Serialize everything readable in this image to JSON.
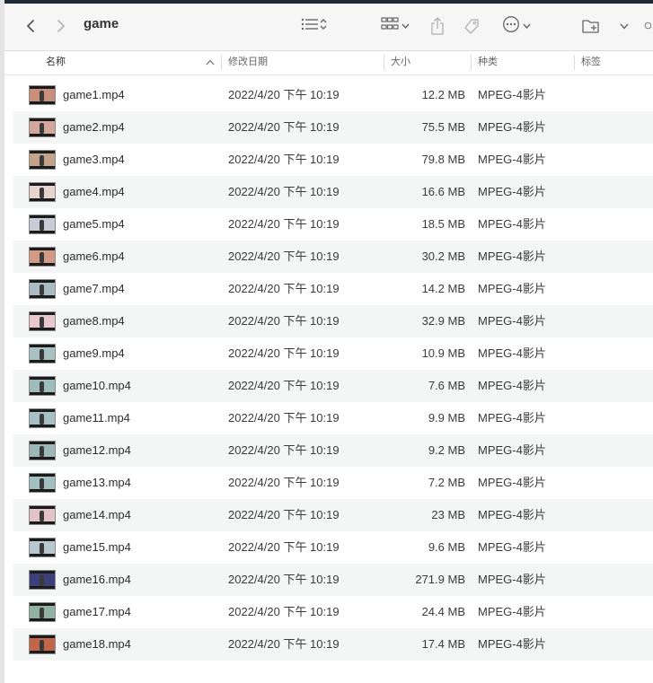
{
  "window": {
    "title": "game"
  },
  "toolbar": {
    "back_icon": "chevron-left-icon",
    "forward_icon": "chevron-right-icon",
    "list_view_icon": "list-icon",
    "grid_view_icon": "grid-icon",
    "share_icon": "share-icon",
    "tag_icon": "tag-icon",
    "more_icon": "ellipsis-circle-icon",
    "new_folder_icon": "folder-plus-icon"
  },
  "columns": {
    "name": "名称",
    "modified": "修改日期",
    "size": "大小",
    "kind": "种类",
    "tags": "标签"
  },
  "files": [
    {
      "name": "game1.mp4",
      "modified": "2022/4/20 下午 10:19",
      "size": "12.2 MB",
      "kind": "MPEG-4影片",
      "thumb": "#c98f7a"
    },
    {
      "name": "game2.mp4",
      "modified": "2022/4/20 下午 10:19",
      "size": "75.5 MB",
      "kind": "MPEG-4影片",
      "thumb": "#d4a79c"
    },
    {
      "name": "game3.mp4",
      "modified": "2022/4/20 下午 10:19",
      "size": "79.8 MB",
      "kind": "MPEG-4影片",
      "thumb": "#c4a28c"
    },
    {
      "name": "game4.mp4",
      "modified": "2022/4/20 下午 10:19",
      "size": "16.6 MB",
      "kind": "MPEG-4影片",
      "thumb": "#e6d5cf"
    },
    {
      "name": "game5.mp4",
      "modified": "2022/4/20 下午 10:19",
      "size": "18.5 MB",
      "kind": "MPEG-4影片",
      "thumb": "#c9ccd6"
    },
    {
      "name": "game6.mp4",
      "modified": "2022/4/20 下午 10:19",
      "size": "30.2 MB",
      "kind": "MPEG-4影片",
      "thumb": "#d39a86"
    },
    {
      "name": "game7.mp4",
      "modified": "2022/4/20 下午 10:19",
      "size": "14.2 MB",
      "kind": "MPEG-4影片",
      "thumb": "#a9bcc4"
    },
    {
      "name": "game8.mp4",
      "modified": "2022/4/20 下午 10:19",
      "size": "32.9 MB",
      "kind": "MPEG-4影片",
      "thumb": "#e8c8cc"
    },
    {
      "name": "game9.mp4",
      "modified": "2022/4/20 下午 10:19",
      "size": "10.9 MB",
      "kind": "MPEG-4影片",
      "thumb": "#a8c2c4"
    },
    {
      "name": "game10.mp4",
      "modified": "2022/4/20 下午 10:19",
      "size": "7.6 MB",
      "kind": "MPEG-4影片",
      "thumb": "#9fbcbc"
    },
    {
      "name": "game11.mp4",
      "modified": "2022/4/20 下午 10:19",
      "size": "9.9 MB",
      "kind": "MPEG-4影片",
      "thumb": "#a7c0c6"
    },
    {
      "name": "game12.mp4",
      "modified": "2022/4/20 下午 10:19",
      "size": "9.2 MB",
      "kind": "MPEG-4影片",
      "thumb": "#9cb8b6"
    },
    {
      "name": "game13.mp4",
      "modified": "2022/4/20 下午 10:19",
      "size": "7.2 MB",
      "kind": "MPEG-4影片",
      "thumb": "#a3c0c0"
    },
    {
      "name": "game14.mp4",
      "modified": "2022/4/20 下午 10:19",
      "size": "23 MB",
      "kind": "MPEG-4影片",
      "thumb": "#e2c4c8"
    },
    {
      "name": "game15.mp4",
      "modified": "2022/4/20 下午 10:19",
      "size": "9.6 MB",
      "kind": "MPEG-4影片",
      "thumb": "#b9c8d0"
    },
    {
      "name": "game16.mp4",
      "modified": "2022/4/20 下午 10:19",
      "size": "271.9 MB",
      "kind": "MPEG-4影片",
      "thumb": "#3b3f7a"
    },
    {
      "name": "game17.mp4",
      "modified": "2022/4/20 下午 10:19",
      "size": "24.4 MB",
      "kind": "MPEG-4影片",
      "thumb": "#8fb2a4"
    },
    {
      "name": "game18.mp4",
      "modified": "2022/4/20 下午 10:19",
      "size": "17.4 MB",
      "kind": "MPEG-4影片",
      "thumb": "#c2664a"
    }
  ]
}
